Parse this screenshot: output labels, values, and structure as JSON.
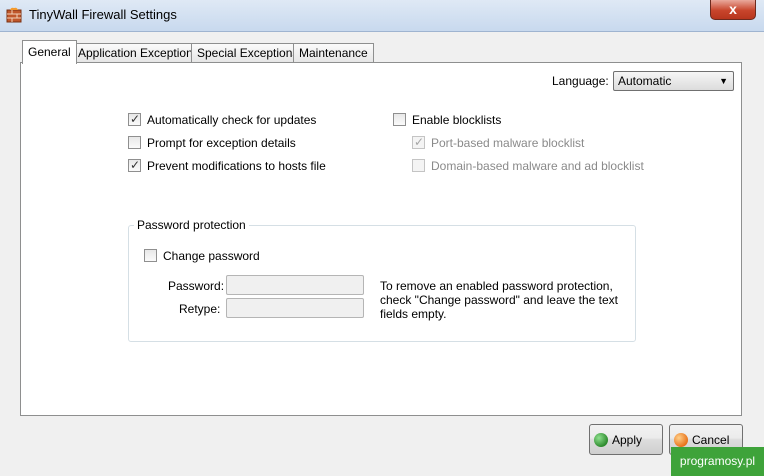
{
  "window": {
    "title": "TinyWall Firewall Settings",
    "close_symbol": "x"
  },
  "tabs": [
    {
      "label": "General",
      "active": true
    },
    {
      "label": "Application Exceptions",
      "active": false
    },
    {
      "label": "Special Exceptions",
      "active": false
    },
    {
      "label": "Maintenance",
      "active": false
    }
  ],
  "general": {
    "language_label": "Language:",
    "language_value": "Automatic",
    "options": [
      {
        "label": "Automatically check for updates",
        "checked": true
      },
      {
        "label": "Prompt for exception details",
        "checked": false
      },
      {
        "label": "Prevent modifications to hosts file",
        "checked": true
      }
    ],
    "blocklists": {
      "label": "Enable blocklists",
      "checked": false,
      "sub": [
        {
          "label": "Port-based malware blocklist",
          "checked": true,
          "disabled": true
        },
        {
          "label": "Domain-based malware and ad blocklist",
          "checked": false,
          "disabled": true
        }
      ]
    },
    "password": {
      "group_title": "Password protection",
      "change_label": "Change password",
      "change_checked": false,
      "password_label": "Password:",
      "retype_label": "Retype:",
      "info_text": "To remove an enabled password protection, check \"Change password\" and leave the text fields empty."
    }
  },
  "buttons": {
    "apply": "Apply",
    "cancel": "Cancel"
  },
  "watermark": "programosy.pl",
  "colors": {
    "apply_icon": "#2e8b2e",
    "cancel_icon": "#e8731a",
    "watermark_bg": "#3ea33a"
  }
}
